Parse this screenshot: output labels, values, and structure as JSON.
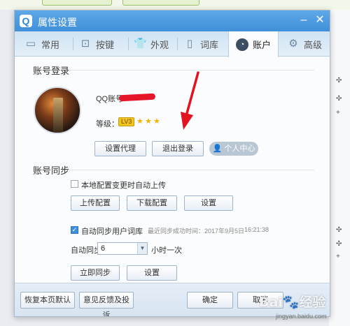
{
  "window": {
    "title": "属性设置",
    "logo_letter": "Q"
  },
  "tabs": [
    {
      "label": "常用",
      "icon": "monitor-icon"
    },
    {
      "label": "按键",
      "icon": "keyboard-icon"
    },
    {
      "label": "外观",
      "icon": "shirt-icon"
    },
    {
      "label": "词库",
      "icon": "book-icon"
    },
    {
      "label": "账户",
      "icon": "user-icon",
      "active": true
    },
    {
      "label": "高级",
      "icon": "gear-icon"
    }
  ],
  "account": {
    "section_title": "账号登录",
    "qq_label": "QQ账号",
    "level_label": "等级：",
    "level_badge": "LV3",
    "stars": 3,
    "proxy_button": "设置代理",
    "logout_button": "退出登录",
    "personal_center_button": "个人中心"
  },
  "sync": {
    "section_title": "账号同步",
    "local_upload_label": "本地配置变更时自动上传",
    "upload_config_button": "上传配置",
    "download_config_button": "下载配置",
    "settings_button": "设置",
    "auto_sync_dict_label": "自动同步用户词库",
    "last_sync_note": "最近同步成功时间：2017年9月5日",
    "last_sync_time": "16:21:38",
    "auto_sync_label": "自动同步",
    "auto_sync_value": "6",
    "interval_unit": "小时一次",
    "sync_now_button": "立即同步",
    "settings_button2": "设置"
  },
  "footer": {
    "restore_button": "恢复本页默认",
    "feedback_button": "意见反馈及投诉",
    "ok_button": "确定",
    "cancel_button": "取消"
  },
  "colors": {
    "titlebar": "#4a98e0",
    "annotation_arrow": "#e3121f"
  }
}
